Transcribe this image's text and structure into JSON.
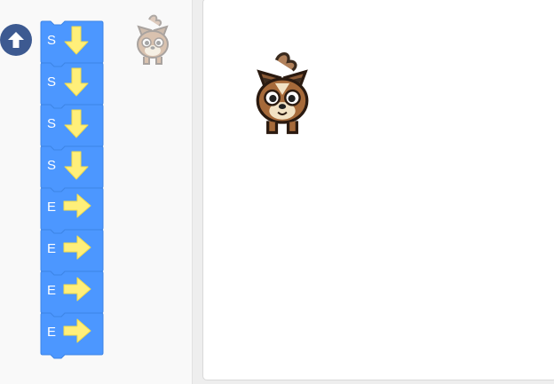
{
  "colors": {
    "block_fill": "#4c97ff",
    "block_stroke": "#3d85e6",
    "arrow": "#ffef7a",
    "flag_button": "#3d5a91",
    "stage_bg": "#ffffff",
    "palette_bg": "#f9f9f9"
  },
  "run_button": {
    "icon": "arrow-up-icon"
  },
  "program": {
    "blocks": [
      {
        "label": "S",
        "direction": "down"
      },
      {
        "label": "S",
        "direction": "down"
      },
      {
        "label": "S",
        "direction": "down"
      },
      {
        "label": "S",
        "direction": "down"
      },
      {
        "label": "E",
        "direction": "right"
      },
      {
        "label": "E",
        "direction": "right"
      },
      {
        "label": "E",
        "direction": "right"
      },
      {
        "label": "E",
        "direction": "right"
      }
    ]
  },
  "sprite": {
    "icon": "cat-sprite-icon",
    "ghost_icon": "cat-ghost-icon"
  }
}
